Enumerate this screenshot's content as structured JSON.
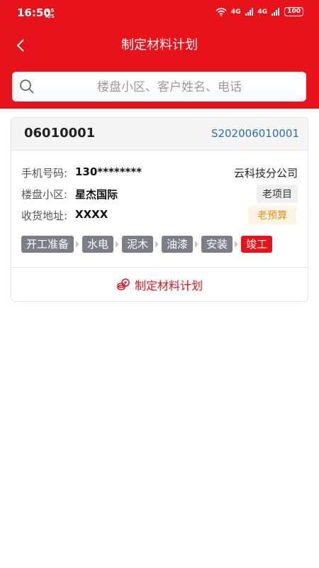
{
  "status_bar": {
    "time": "16:50",
    "speed_value": "4.5",
    "speed_unit": "K/S",
    "net1": "4G",
    "net2": "4G",
    "battery": "100"
  },
  "nav": {
    "title": "制定材料计划"
  },
  "search": {
    "placeholder": "楼盘小区、客户姓名、电话",
    "value": ""
  },
  "card": {
    "order_no": "06010001",
    "serial": "S202006010001",
    "phone_label": "手机号码:",
    "phone_value": "130********",
    "company": "云科技分公司",
    "community_label": "楼盘小区:",
    "community_value": "星杰国际",
    "project_tag": "老项目",
    "address_label": "收货地址:",
    "address_value": "XXXX",
    "budget_tag": "老预算",
    "stages": [
      {
        "label": "开工准备",
        "active": false
      },
      {
        "label": "水电",
        "active": false
      },
      {
        "label": "泥木",
        "active": false
      },
      {
        "label": "油漆",
        "active": false
      },
      {
        "label": "安装",
        "active": false
      },
      {
        "label": "竣工",
        "active": true
      }
    ],
    "action_label": "制定材料计划"
  },
  "colors": {
    "brand_red": "#e8121b",
    "stage_gray": "#7c7f88",
    "link_blue": "#2a6db8",
    "budget_orange": "#e8901d"
  },
  "icons": {
    "back": "chevron-left-icon",
    "search": "search-icon",
    "action": "coins-icon"
  }
}
